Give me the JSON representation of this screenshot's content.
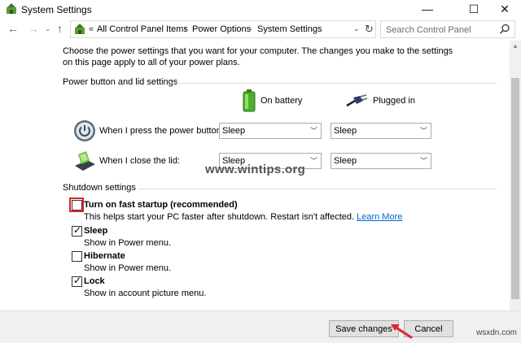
{
  "window": {
    "title": "System Settings",
    "min_glyph": "—",
    "max_glyph": "☐",
    "close_glyph": "✕"
  },
  "nav": {
    "back_glyph": "←",
    "forward_glyph": "→",
    "history_glyph": "⌄",
    "up_glyph": "↑",
    "address_prefix": "«",
    "breadcrumbs": [
      "All Control Panel Items",
      "Power Options",
      "System Settings"
    ],
    "separator": "›",
    "dropdown_glyph": "⌄",
    "refresh_glyph": "↻",
    "search_placeholder": "Search Control Panel"
  },
  "content": {
    "intro": "Choose the power settings that you want for your computer. The changes you make to the settings on this page apply to all of your power plans.",
    "power_group_title": "Power button and lid settings",
    "columns": {
      "battery": "On battery",
      "plugged": "Plugged in"
    },
    "rows": [
      {
        "label": "When I press the power button:",
        "battery": "Sleep",
        "plugged": "Sleep"
      },
      {
        "label": "When I close the lid:",
        "battery": "Sleep",
        "plugged": "Sleep"
      }
    ],
    "shutdown_group_title": "Shutdown settings",
    "options": [
      {
        "label": "Turn on fast startup (recommended)",
        "desc": "This helps start your PC faster after shutdown. Restart isn't affected.",
        "link": "Learn More",
        "checked": false
      },
      {
        "label": "Sleep",
        "desc": "Show in Power menu.",
        "checked": true
      },
      {
        "label": "Hibernate",
        "desc": "Show in Power menu.",
        "checked": false
      },
      {
        "label": "Lock",
        "desc": "Show in account picture menu.",
        "checked": true
      }
    ],
    "watermark": "www.wintips.org"
  },
  "footer": {
    "save_label": "Save changes",
    "cancel_label": "Cancel",
    "corner_watermark": "wsxdn.com"
  },
  "colors": {
    "highlight": "#e0242c",
    "link": "#0066cc",
    "footer_bg": "#f0f0f0"
  }
}
